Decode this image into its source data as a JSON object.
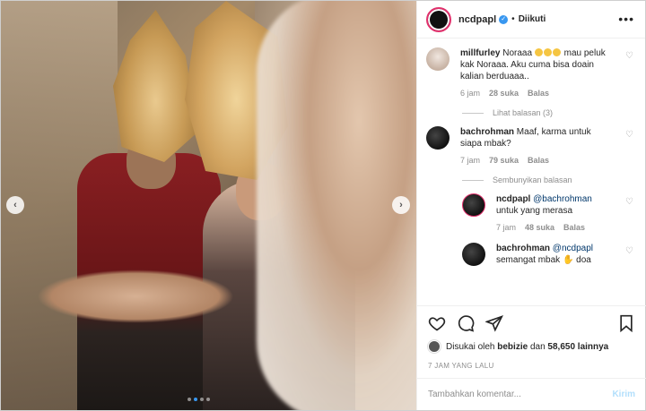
{
  "post": {
    "username": "ncdpapl",
    "follow_state": "Diikuti",
    "separator": "•"
  },
  "comments": [
    {
      "username": "millfurley",
      "text_before": "Noraaa",
      "text_after": "mau peluk kak Noraaa. Aku cuma bisa doain kalian berduaaa..",
      "time": "6 jam",
      "likes": "28 suka",
      "reply": "Balas",
      "toggle": "Lihat balasan (3)"
    },
    {
      "username": "bachrohman",
      "text": "Maaf, karma untuk siapa mbak?",
      "time": "7 jam",
      "likes": "79 suka",
      "reply": "Balas",
      "toggle": "Sembunyikan balasan"
    }
  ],
  "replies": [
    {
      "username": "ncdpapl",
      "mention": "@bachrohman",
      "text": "untuk yang merasa",
      "time": "7 jam",
      "likes": "48 suka",
      "reply": "Balas"
    },
    {
      "username": "bachrohman",
      "mention": "@ncdpapl",
      "text": "semangat mbak",
      "text_after": "doa"
    }
  ],
  "likes": {
    "prefix": "Disukai oleh",
    "user": "bebizie",
    "middle": "dan",
    "count": "58,650 lainnya"
  },
  "timestamp": "7 JAM YANG LALU",
  "add_comment": {
    "placeholder": "Tambahkan komentar...",
    "post_label": "Kirim"
  },
  "icons": {
    "like": "heart-icon",
    "comment": "comment-icon",
    "share": "share-icon",
    "save": "bookmark-icon",
    "more": "more-icon",
    "verified": "verified-badge-icon"
  },
  "colors": {
    "link": "#00376b",
    "verified": "#3897f0",
    "muted": "#8e8e8e",
    "post_disabled": "#b2dffc"
  }
}
